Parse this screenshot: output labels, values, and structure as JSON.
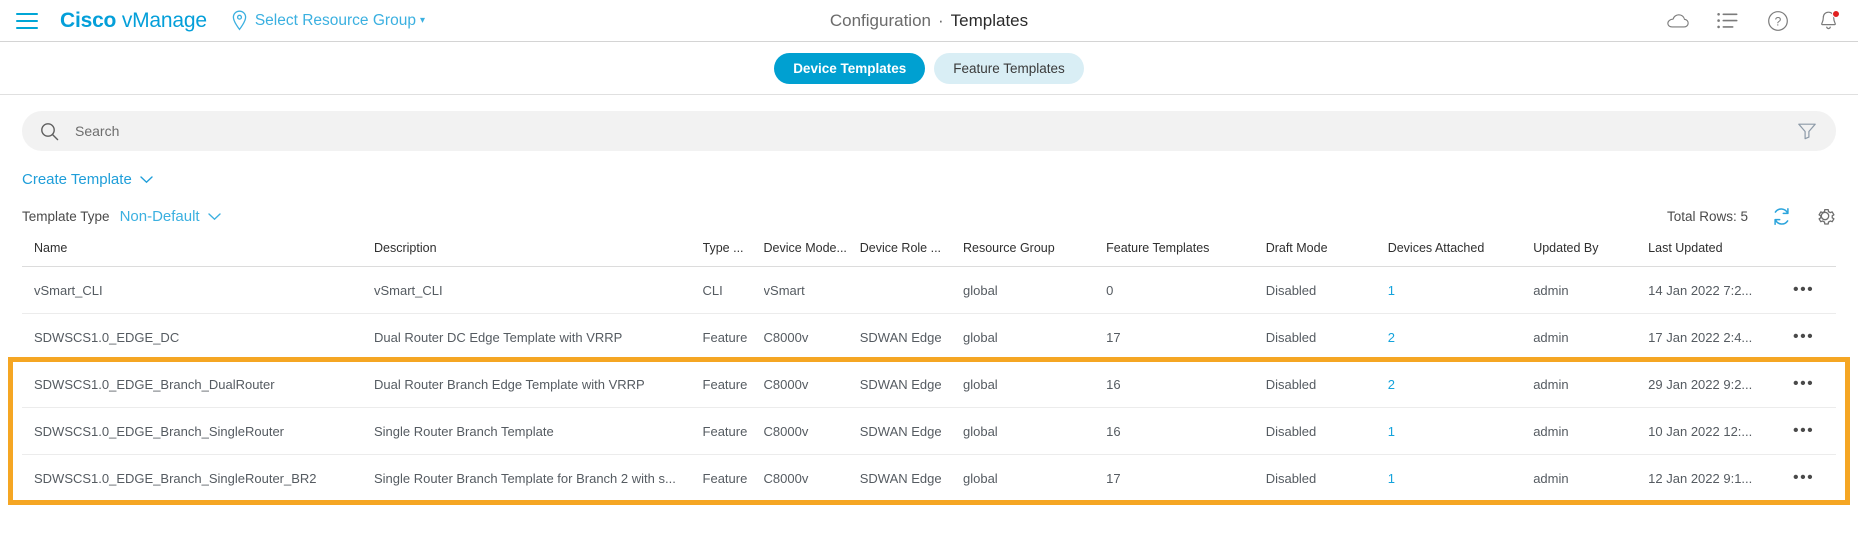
{
  "header": {
    "menu_icon": "hamburger-menu-icon",
    "brand_bold": "Cisco",
    "brand_light": "vManage",
    "resource_group_label": "Select Resource Group",
    "resource_group_caret": "▾",
    "breadcrumb_parent": "Configuration",
    "breadcrumb_sep": "·",
    "breadcrumb_current": "Templates",
    "icons": [
      {
        "name": "cloud-icon"
      },
      {
        "name": "tasks-list-icon"
      },
      {
        "name": "help-icon"
      },
      {
        "name": "notifications-bell-icon",
        "badge": true
      }
    ]
  },
  "tabs": [
    {
      "label": "Device Templates",
      "active": true
    },
    {
      "label": "Feature Templates",
      "active": false
    }
  ],
  "search": {
    "placeholder": "Search",
    "value": "",
    "icon": "search-icon",
    "filter_icon": "filter-funnel-icon"
  },
  "toolbar": {
    "create_template_label": "Create Template",
    "create_template_caret": "⌄",
    "template_type_label": "Template Type",
    "template_type_value": "Non-Default",
    "template_type_caret": "⌄",
    "total_rows_label": "Total Rows: 5",
    "refresh_icon": "refresh-icon",
    "settings_icon": "gear-icon"
  },
  "table": {
    "columns": [
      "Name",
      "Description",
      "Type ...",
      "Device Mode...",
      "Device Role ...",
      "Resource Group",
      "Feature Templates",
      "Draft Mode",
      "Devices Attached",
      "Updated By",
      "Last Updated",
      ""
    ],
    "rows": [
      {
        "name": "vSmart_CLI",
        "description": "vSmart_CLI",
        "type": "CLI",
        "device_model": "vSmart",
        "device_role": "",
        "resource_group": "global",
        "feature_templates": "0",
        "draft_mode": "Disabled",
        "devices_attached": "1",
        "updated_by": "admin",
        "last_updated": "14 Jan 2022 7:2...",
        "actions": "•••",
        "highlighted": false
      },
      {
        "name": "SDWSCS1.0_EDGE_DC",
        "description": "Dual Router DC Edge Template with VRRP",
        "type": "Feature",
        "device_model": "C8000v",
        "device_role": "SDWAN Edge",
        "resource_group": "global",
        "feature_templates": "17",
        "draft_mode": "Disabled",
        "devices_attached": "2",
        "updated_by": "admin",
        "last_updated": "17 Jan 2022 2:4...",
        "actions": "•••",
        "highlighted": false
      },
      {
        "name": "SDWSCS1.0_EDGE_Branch_DualRouter",
        "description": "Dual Router Branch Edge Template with VRRP",
        "type": "Feature",
        "device_model": "C8000v",
        "device_role": "SDWAN Edge",
        "resource_group": "global",
        "feature_templates": "16",
        "draft_mode": "Disabled",
        "devices_attached": "2",
        "updated_by": "admin",
        "last_updated": "29 Jan 2022 9:2...",
        "actions": "•••",
        "highlighted": true
      },
      {
        "name": "SDWSCS1.0_EDGE_Branch_SingleRouter",
        "description": "Single Router Branch Template",
        "type": "Feature",
        "device_model": "C8000v",
        "device_role": "SDWAN Edge",
        "resource_group": "global",
        "feature_templates": "16",
        "draft_mode": "Disabled",
        "devices_attached": "1",
        "updated_by": "admin",
        "last_updated": "10 Jan 2022 12:...",
        "actions": "•••",
        "highlighted": true
      },
      {
        "name": "SDWSCS1.0_EDGE_Branch_SingleRouter_BR2",
        "description": "Single Router Branch Template for Branch 2 with s...",
        "type": "Feature",
        "device_model": "C8000v",
        "device_role": "SDWAN Edge",
        "resource_group": "global",
        "feature_templates": "17",
        "draft_mode": "Disabled",
        "devices_attached": "1",
        "updated_by": "admin",
        "last_updated": "12 Jan 2022 9:1...",
        "actions": "•••",
        "highlighted": true
      }
    ]
  },
  "colors": {
    "cisco_blue": "#049fd9",
    "link_blue": "#14a3dc",
    "active_tab": "#00a0d1",
    "inactive_tab_bg": "#d9eef5",
    "highlight_orange": "#f5a623",
    "badge_red": "#e02020"
  }
}
